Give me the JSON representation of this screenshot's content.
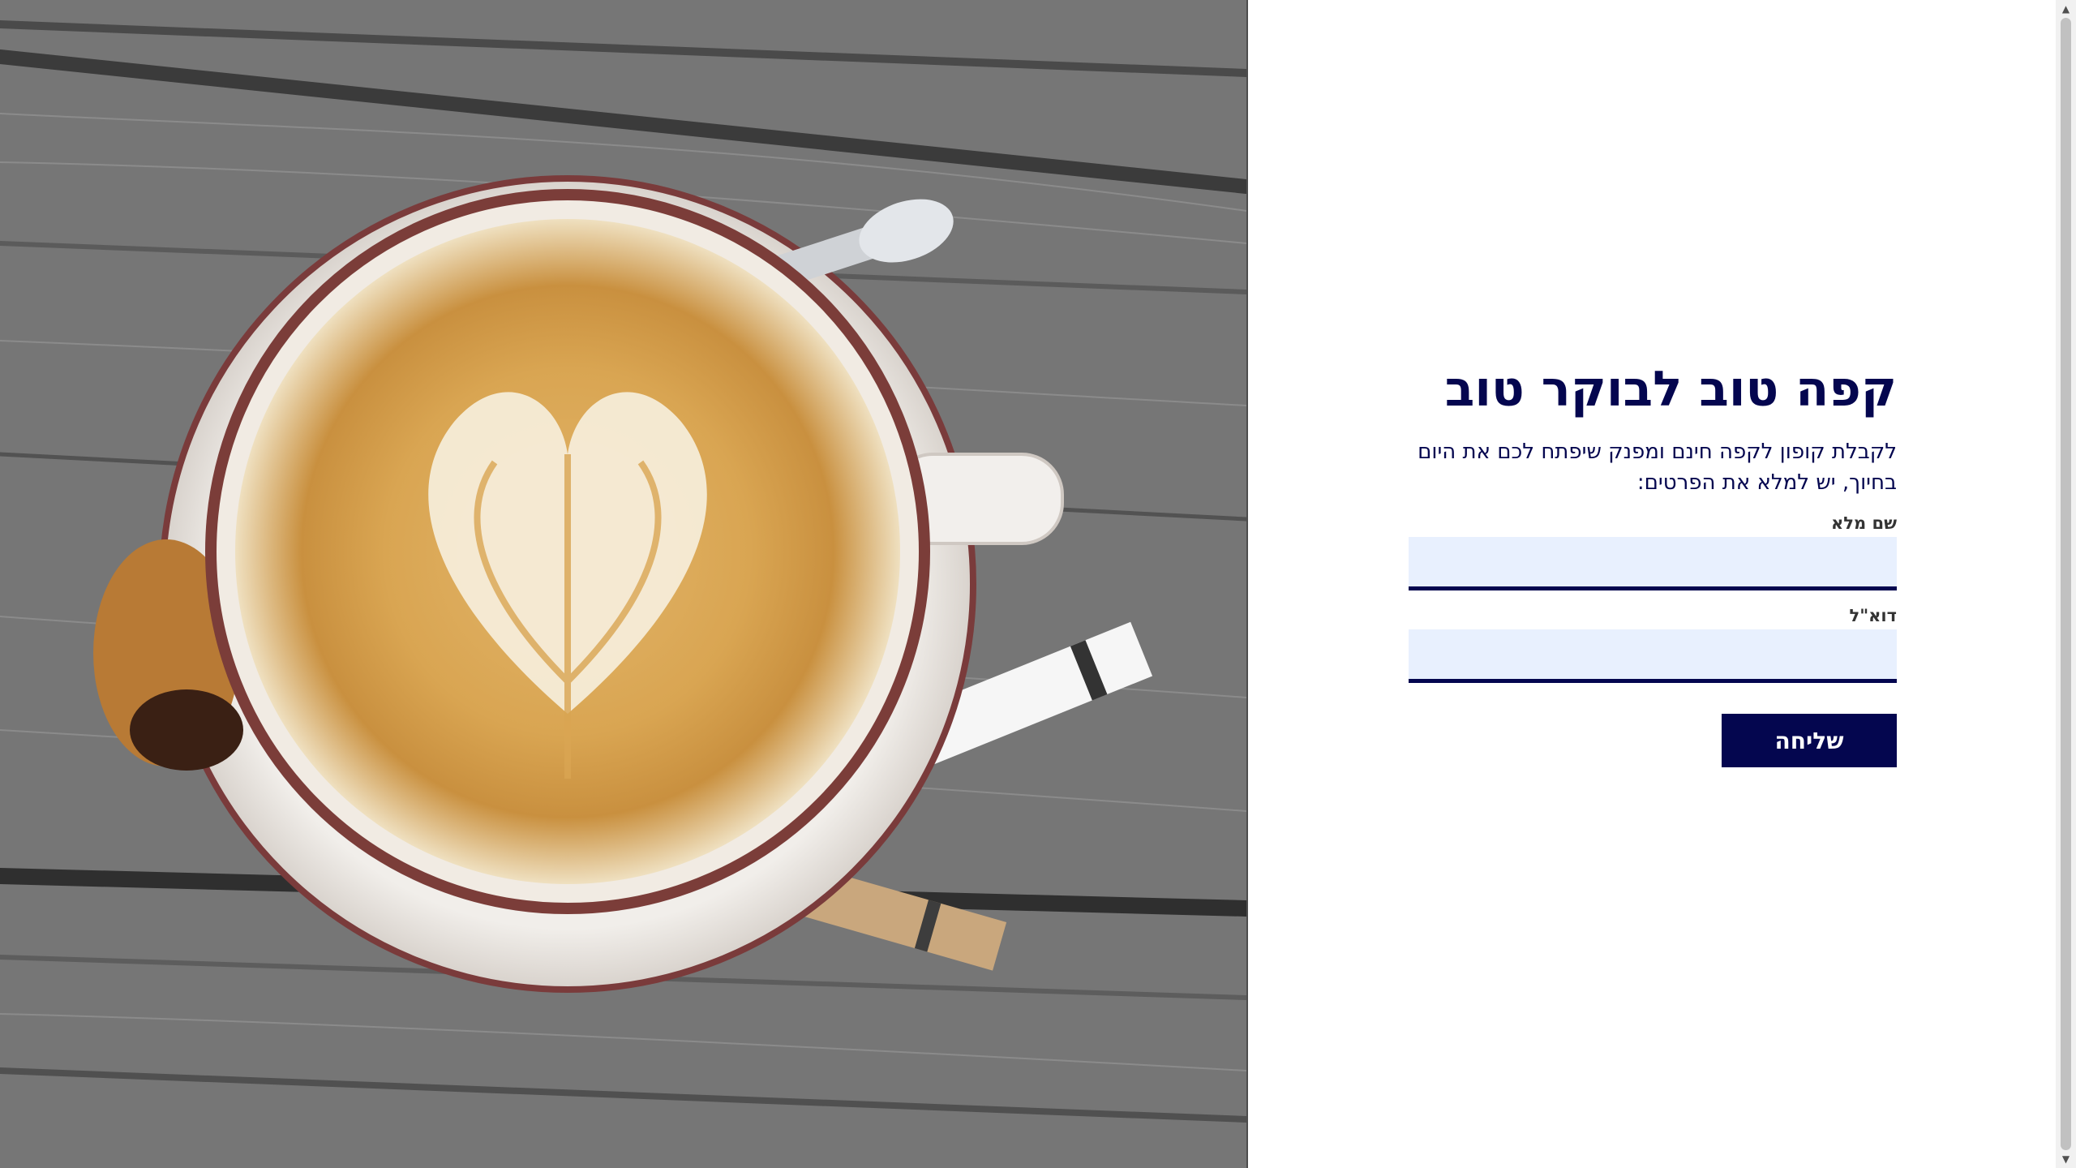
{
  "hero": {
    "image_alt": "coffee-cup-photo"
  },
  "form": {
    "title": "קפה טוב לבוקר טוב",
    "intro": "לקבלת קופון לקפה חינם ומפנק שיפתח לכם את היום בחיוך, יש למלא את הפרטים:",
    "fields": [
      {
        "label": "שם מלא",
        "value": "",
        "placeholder": ""
      },
      {
        "label": "דוא\"ל",
        "value": "",
        "placeholder": ""
      }
    ],
    "submit_label": "שליחה"
  },
  "scrollbar": {
    "up_arrow": "▲",
    "down_arrow": "▼"
  },
  "colors": {
    "brand": "#04064f",
    "input_bg": "#e8f0fe"
  }
}
